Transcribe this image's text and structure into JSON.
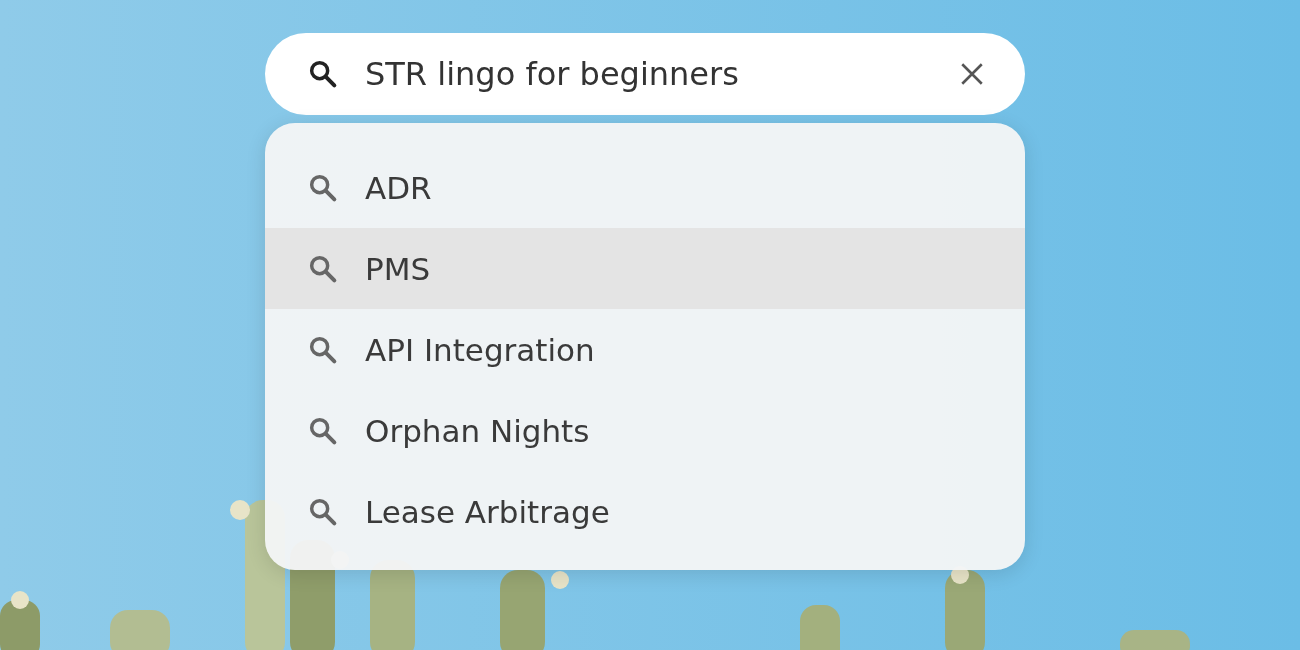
{
  "search": {
    "value": "STR lingo for beginners"
  },
  "suggestions": [
    {
      "label": "ADR",
      "selected": false
    },
    {
      "label": "PMS",
      "selected": true
    },
    {
      "label": "API Integration",
      "selected": false
    },
    {
      "label": "Orphan Nights",
      "selected": false
    },
    {
      "label": "Lease Arbitrage",
      "selected": false
    }
  ]
}
